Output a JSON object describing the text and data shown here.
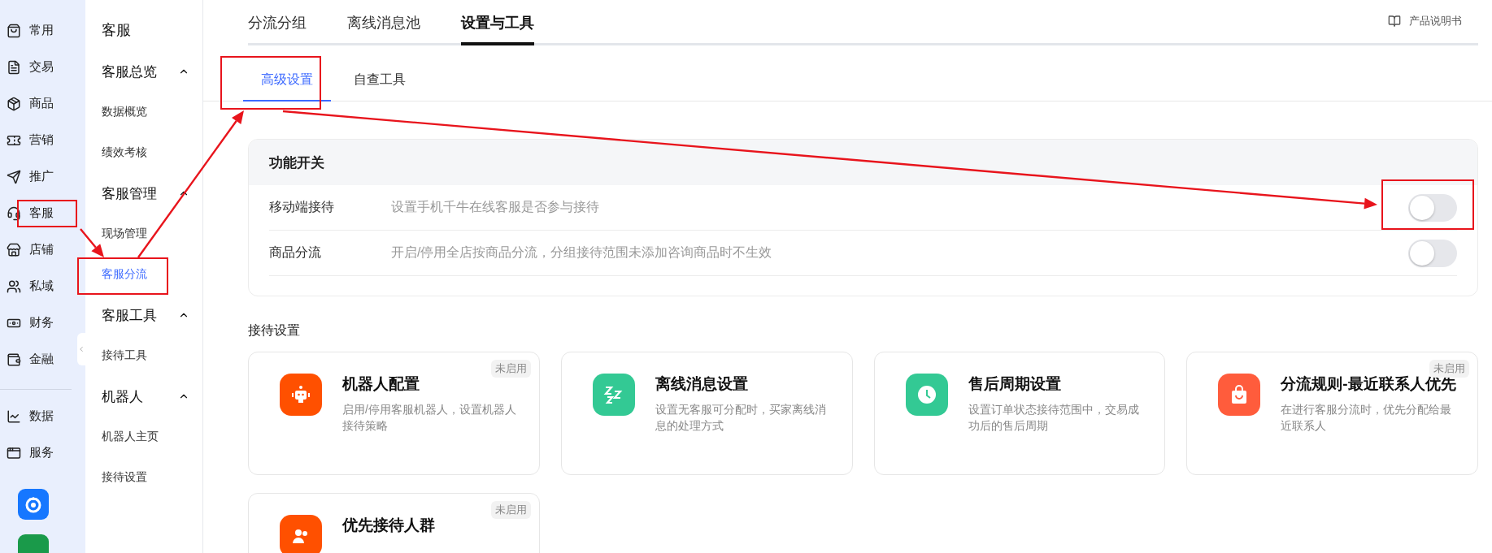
{
  "rail": {
    "items": [
      {
        "label": "常用"
      },
      {
        "label": "交易"
      },
      {
        "label": "商品"
      },
      {
        "label": "营销"
      },
      {
        "label": "推广"
      },
      {
        "label": "客服"
      },
      {
        "label": "店铺"
      },
      {
        "label": "私域"
      },
      {
        "label": "财务"
      },
      {
        "label": "金融"
      }
    ],
    "bottom_items": [
      {
        "label": "数据"
      },
      {
        "label": "服务"
      }
    ]
  },
  "subnav": {
    "title": "客服",
    "groups": [
      {
        "label": "客服总览",
        "expanded": true,
        "items": [
          {
            "label": "数据概览",
            "selected": false
          },
          {
            "label": "绩效考核",
            "selected": false
          }
        ]
      },
      {
        "label": "客服管理",
        "expanded": true,
        "items": [
          {
            "label": "现场管理",
            "selected": false
          },
          {
            "label": "客服分流",
            "selected": true
          }
        ]
      },
      {
        "label": "客服工具",
        "expanded": true,
        "items": [
          {
            "label": "接待工具",
            "selected": false
          }
        ]
      },
      {
        "label": "机器人",
        "expanded": true,
        "items": [
          {
            "label": "机器人主页",
            "selected": false
          },
          {
            "label": "接待设置",
            "selected": false
          }
        ]
      }
    ]
  },
  "tabs": [
    {
      "label": "分流分组",
      "selected": false
    },
    {
      "label": "离线消息池",
      "selected": false
    },
    {
      "label": "设置与工具",
      "selected": true
    }
  ],
  "manual_link": "产品说明书",
  "subtabs": [
    {
      "label": "高级设置",
      "selected": true
    },
    {
      "label": "自查工具",
      "selected": false
    }
  ],
  "switch_panel": {
    "title": "功能开关",
    "rows": [
      {
        "name": "移动端接待",
        "description": "设置手机千牛在线客服是否参与接待",
        "on": false
      },
      {
        "name": "商品分流",
        "description": "开启/停用全店按商品分流，分组接待范围未添加咨询商品时不生效",
        "on": false
      }
    ]
  },
  "reception": {
    "title": "接待设置",
    "cards": [
      {
        "title": "机器人配置",
        "description": "启用/停用客服机器人，设置机器人接待策略",
        "badge": "未启用",
        "kind": "robot",
        "color": "#ff5000"
      },
      {
        "title": "离线消息设置",
        "description": "设置无客服可分配时，买家离线消息的处理方式",
        "kind": "sleep",
        "color": "#33c994"
      },
      {
        "title": "售后周期设置",
        "description": "设置订单状态接待范围中，交易成功后的售后周期",
        "kind": "clock",
        "color": "#33c994"
      },
      {
        "title": "分流规则-最近联系人优先",
        "description": "在进行客服分流时，优先分配给最近联系人",
        "badge": "未启用",
        "kind": "bag",
        "color": "#ff5c3c"
      },
      {
        "title": "优先接待人群",
        "badge": "未启用",
        "kind": "people",
        "color": "#ff5000"
      }
    ]
  }
}
